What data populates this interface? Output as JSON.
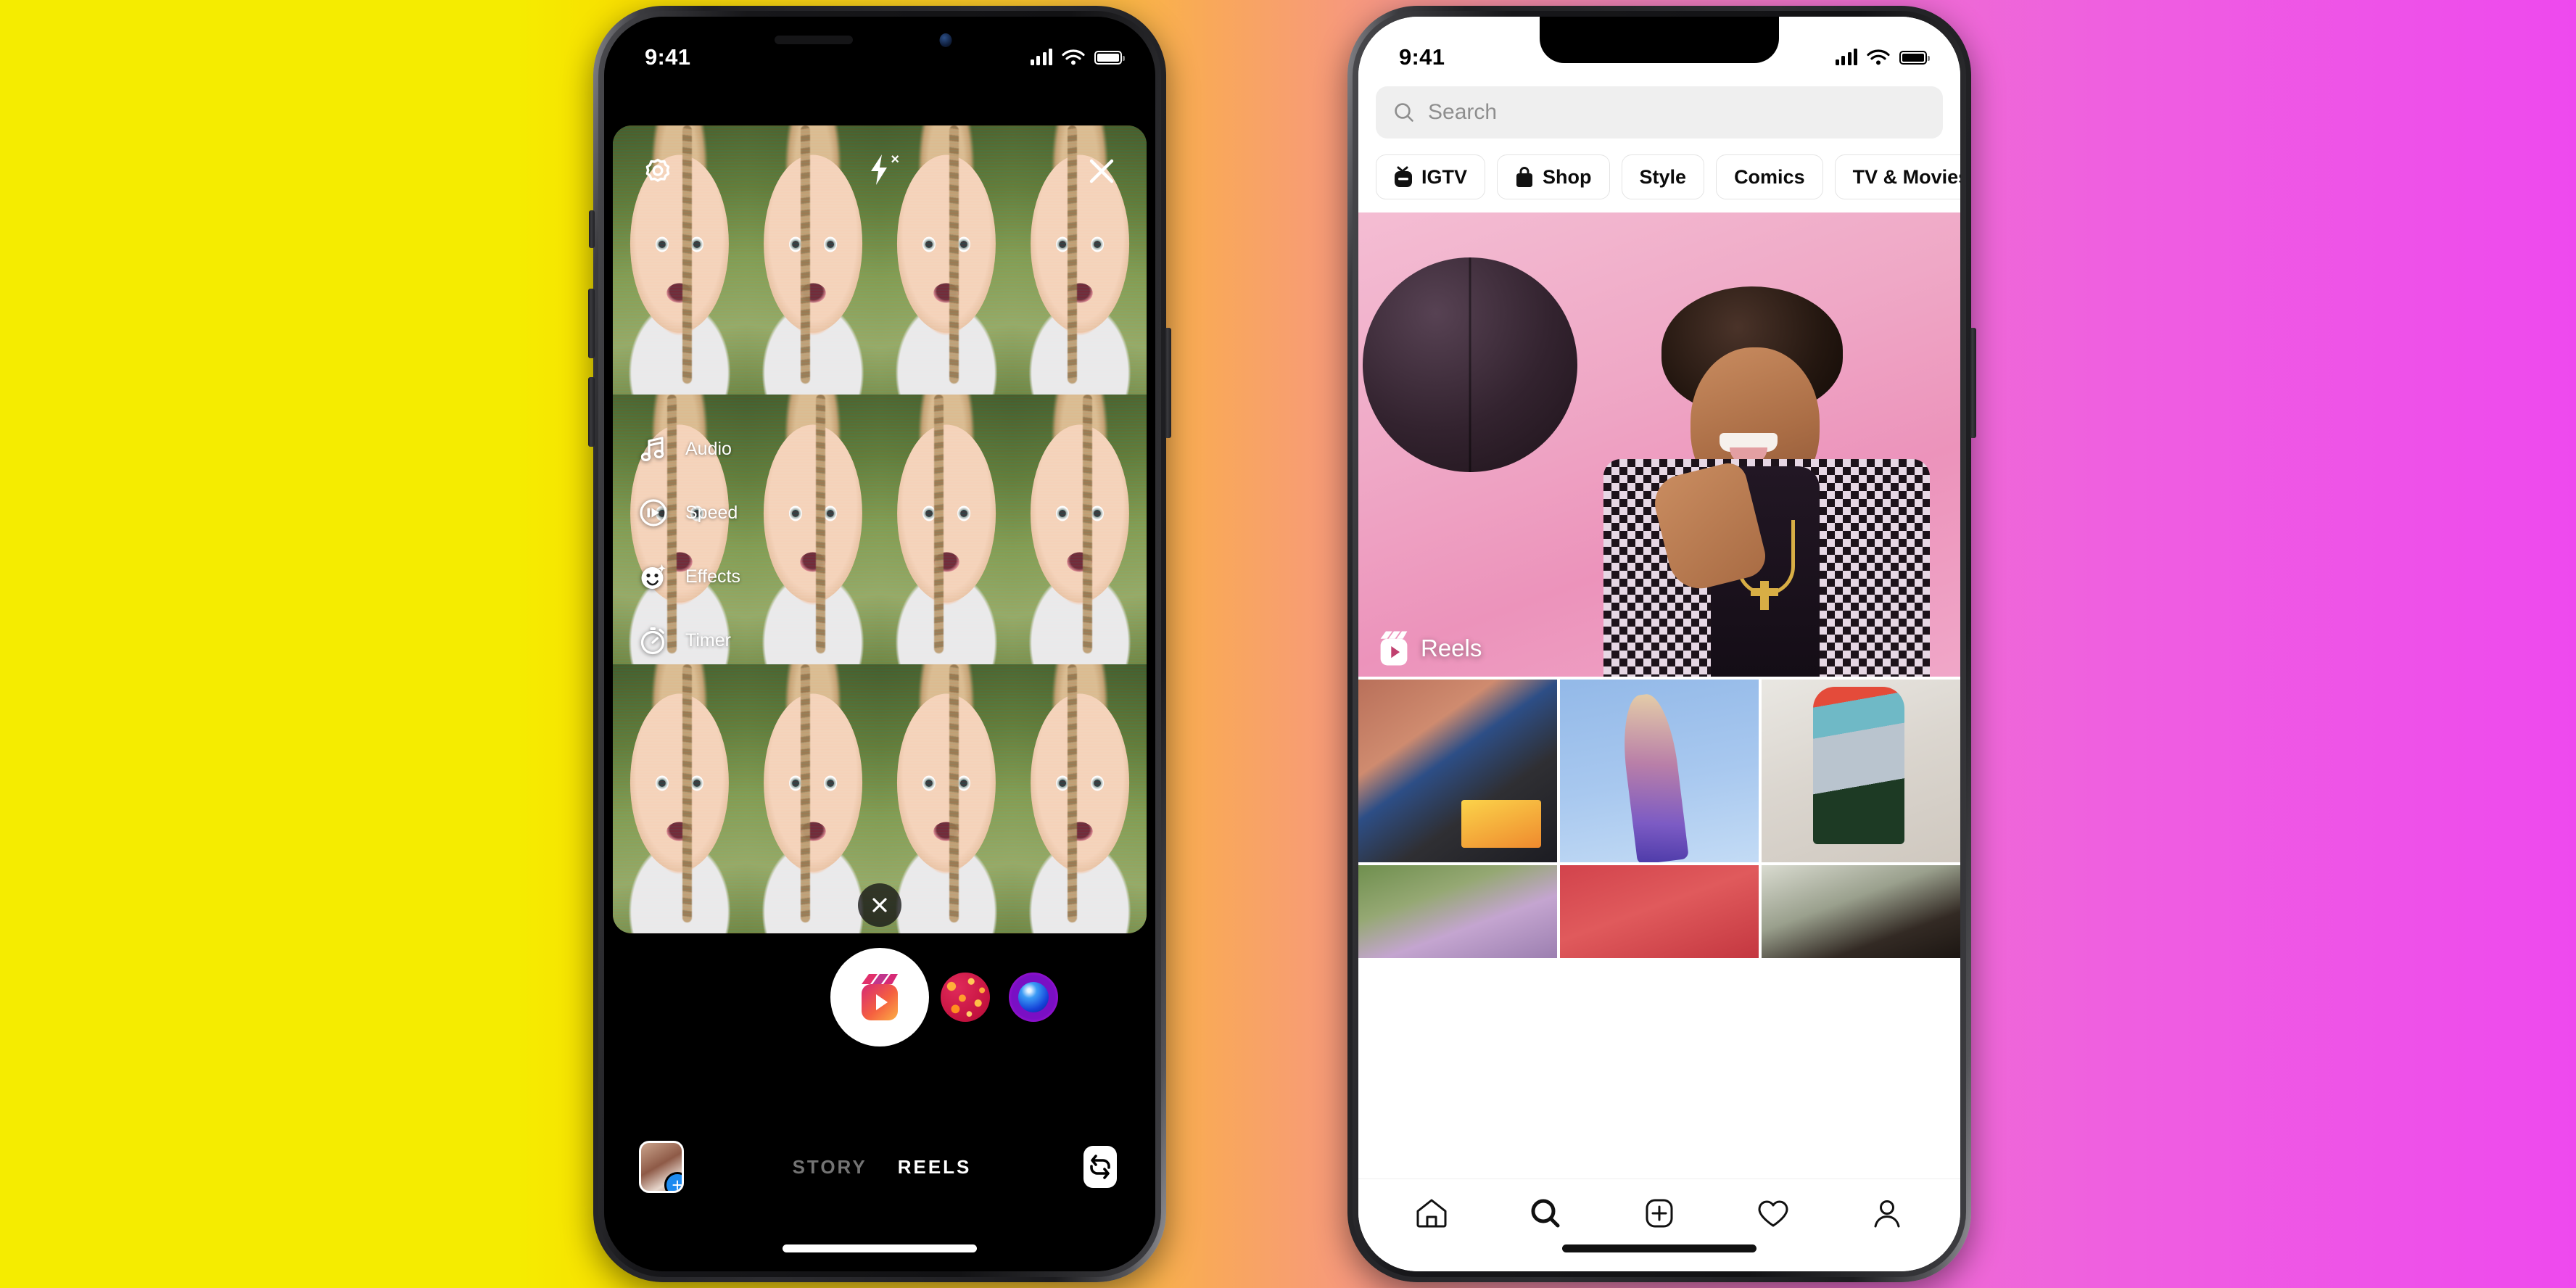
{
  "background": {
    "gradient_from": "#f5ec00",
    "gradient_mid": "#f79a7a",
    "gradient_to": "#ee49ee"
  },
  "left_phone": {
    "status_bar": {
      "time": "9:41",
      "cellular_icon": "signal-bars-icon",
      "wifi_icon": "wifi-icon",
      "battery_icon": "battery-icon"
    },
    "camera": {
      "settings_label": "settings-gear",
      "flash_label": "flash-off",
      "close_label": "close",
      "tools": [
        {
          "label": "Audio",
          "icon": "music-note-icon"
        },
        {
          "label": "Speed",
          "icon": "speed-icon"
        },
        {
          "label": "Effects",
          "icon": "effects-face-icon"
        },
        {
          "label": "Timer",
          "icon": "timer-icon"
        }
      ],
      "dismiss_effect_label": "×",
      "shutter_icon": "reels-clapper-icon",
      "effect_thumbnails": [
        {
          "name": "sparkle-effect"
        },
        {
          "name": "blue-orb-effect"
        }
      ],
      "gallery_icon": "gallery-thumbnail",
      "gallery_add_badge": "+",
      "flip_camera_icon": "flip-camera-icon",
      "modes": [
        {
          "label": "STORY",
          "active": false
        },
        {
          "label": "REELS",
          "active": true
        }
      ]
    }
  },
  "right_phone": {
    "status_bar": {
      "time": "9:41",
      "cellular_icon": "signal-bars-icon",
      "wifi_icon": "wifi-icon",
      "battery_icon": "battery-icon"
    },
    "explore": {
      "search": {
        "placeholder": "Search",
        "icon": "search-icon"
      },
      "chips": [
        {
          "label": "IGTV",
          "icon": "igtv-icon"
        },
        {
          "label": "Shop",
          "icon": "shopping-bag-icon"
        },
        {
          "label": "Style",
          "icon": ""
        },
        {
          "label": "Comics",
          "icon": ""
        },
        {
          "label": "TV & Movies",
          "icon": ""
        }
      ],
      "hero_post": {
        "badge_label": "Reels",
        "badge_icon": "reels-clapper-icon"
      },
      "grid": [
        {
          "name": "grid-cell-1"
        },
        {
          "name": "grid-cell-2"
        },
        {
          "name": "grid-cell-3"
        },
        {
          "name": "grid-cell-4"
        },
        {
          "name": "grid-cell-5"
        },
        {
          "name": "grid-cell-6"
        }
      ],
      "nav": [
        {
          "name": "nav-home",
          "icon": "home-icon",
          "active": false
        },
        {
          "name": "nav-search",
          "icon": "search-icon",
          "active": true
        },
        {
          "name": "nav-create",
          "icon": "plus-box-icon",
          "active": false
        },
        {
          "name": "nav-activity",
          "icon": "heart-icon",
          "active": false
        },
        {
          "name": "nav-profile",
          "icon": "person-icon",
          "active": false
        }
      ]
    }
  }
}
